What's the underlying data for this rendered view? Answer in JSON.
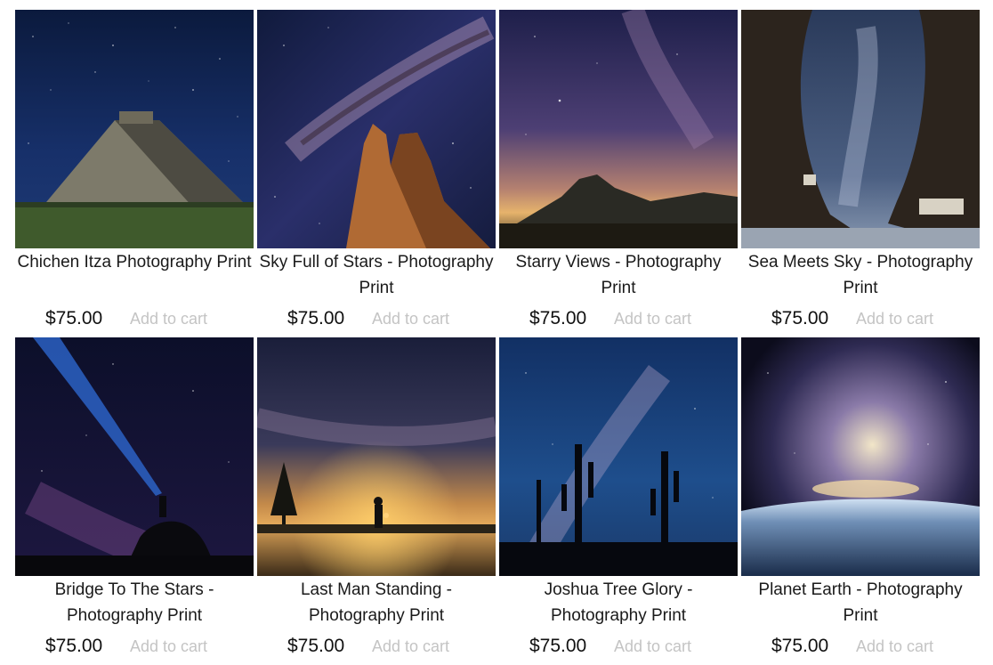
{
  "products": [
    {
      "title": "Chichen Itza Photography Print",
      "price": "$75.00",
      "cta": "Add to cart"
    },
    {
      "title": "Sky Full of Stars - Photography Print",
      "price": "$75.00",
      "cta": "Add to cart"
    },
    {
      "title": "Starry Views - Photography Print",
      "price": "$75.00",
      "cta": "Add to cart"
    },
    {
      "title": "Sea Meets Sky - Photography Print",
      "price": "$75.00",
      "cta": "Add to cart"
    },
    {
      "title": "Bridge To The Stars - Photography Print",
      "price": "$75.00",
      "cta": "Add to cart"
    },
    {
      "title": "Last Man Standing - Photography Print",
      "price": "$75.00",
      "cta": "Add to cart"
    },
    {
      "title": "Joshua Tree Glory - Photography Print",
      "price": "$75.00",
      "cta": "Add to cart"
    },
    {
      "title": "Planet Earth - Photography Print",
      "price": "$75.00",
      "cta": "Add to cart"
    }
  ],
  "colors": {
    "price_text": "#111111",
    "cta_text": "#c4c4c4"
  }
}
